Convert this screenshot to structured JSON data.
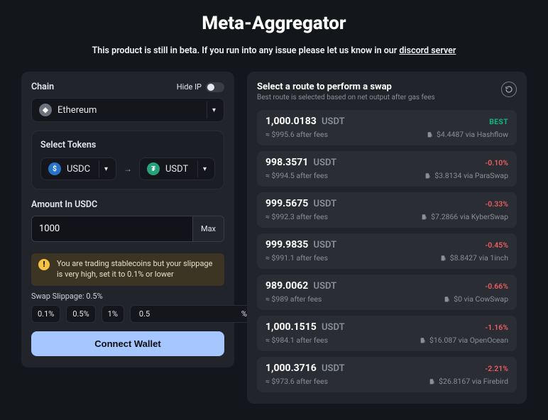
{
  "title": "Meta-Aggregator",
  "subtitle_pre": "This product is still in beta. If you run into any issue please let us know in our ",
  "subtitle_link": "discord server",
  "left": {
    "chain_label": "Chain",
    "hide_ip_label": "Hide IP",
    "chain_value": "Ethereum",
    "select_tokens_label": "Select Tokens",
    "from_token": "USDC",
    "to_token": "USDT",
    "amount_label": "Amount In USDC",
    "amount_value": "1000",
    "max_label": "Max",
    "warn_text": "You are trading stablecoins but your slippage is very high, set it to 0.1% or lower",
    "slippage_label": "Swap Slippage: 0.5%",
    "slip_presets": [
      "0.1%",
      "0.5%",
      "1%"
    ],
    "slip_custom": "0.5",
    "pct_sign": "%",
    "connect_label": "Connect Wallet"
  },
  "right": {
    "title": "Select a route to perform a swap",
    "subtitle": "Best route is selected based on net output after gas fees",
    "token_symbol": "USDT",
    "best_label": "BEST",
    "routes": [
      {
        "amount": "1,000.0183",
        "after": "≈ $995.6 after fees",
        "gas": "$4.4487",
        "via": "via Hashflow",
        "diff": "",
        "best": true
      },
      {
        "amount": "998.3571",
        "after": "≈ $994.5 after fees",
        "gas": "$3.8134",
        "via": "via ParaSwap",
        "diff": "-0.10%",
        "best": false
      },
      {
        "amount": "999.5675",
        "after": "≈ $992.3 after fees",
        "gas": "$7.2866",
        "via": "via KyberSwap",
        "diff": "-0.33%",
        "best": false
      },
      {
        "amount": "999.9835",
        "after": "≈ $991.1 after fees",
        "gas": "$8.8427",
        "via": "via 1inch",
        "diff": "-0.45%",
        "best": false
      },
      {
        "amount": "989.0062",
        "after": "≈ $989 after fees",
        "gas": "$0",
        "via": "via CowSwap",
        "diff": "-0.66%",
        "best": false
      },
      {
        "amount": "1,000.1515",
        "after": "≈ $984.1 after fees",
        "gas": "$16.087",
        "via": "via OpenOcean",
        "diff": "-1.16%",
        "best": false
      },
      {
        "amount": "1,000.3716",
        "after": "≈ $973.6 after fees",
        "gas": "$26.8167",
        "via": "via Firebird",
        "diff": "-2.21%",
        "best": false
      }
    ]
  }
}
